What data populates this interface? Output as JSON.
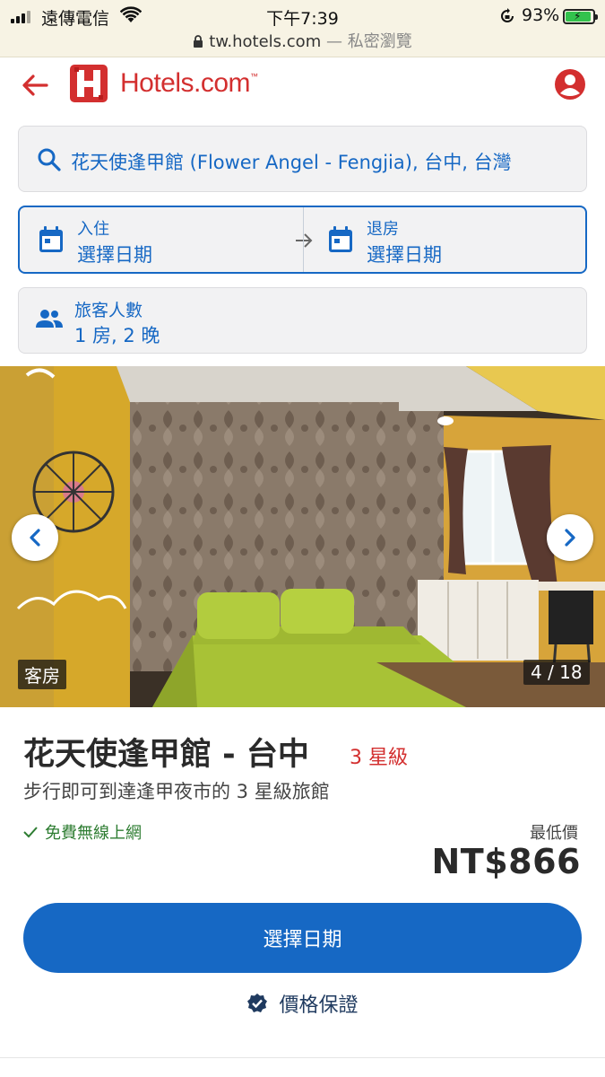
{
  "status_bar": {
    "carrier": "遠傳電信",
    "time": "下午7:39",
    "battery": "93%",
    "url": "tw.hotels.com",
    "private_label": "— 私密瀏覽"
  },
  "header": {
    "logo_text": "Hotels.com",
    "logo_tm": "™"
  },
  "search": {
    "destination": "花天使逢甲館 (Flower Angel - Fengjia), 台中, 台灣",
    "checkin_label": "入住",
    "checkin_value": "選擇日期",
    "checkout_label": "退房",
    "checkout_value": "選擇日期",
    "guests_label": "旅客人數",
    "guests_value": "1 房, 2 晚"
  },
  "gallery": {
    "tag": "客房",
    "counter": "4 / 18"
  },
  "hotel": {
    "name": "花天使逢甲館 - 台中",
    "stars": "3 星級",
    "tagline": "步行即可到達逢甲夜市的 3 星級旅館",
    "amenity": "免費無線上網",
    "price_label": "最低價",
    "price": "NT$866"
  },
  "actions": {
    "select_dates": "選擇日期",
    "price_guarantee": "價格保證"
  },
  "colors": {
    "brand_red": "#d32f2f",
    "accent_blue": "#1668c4",
    "amenity_green": "#2e7d32"
  }
}
